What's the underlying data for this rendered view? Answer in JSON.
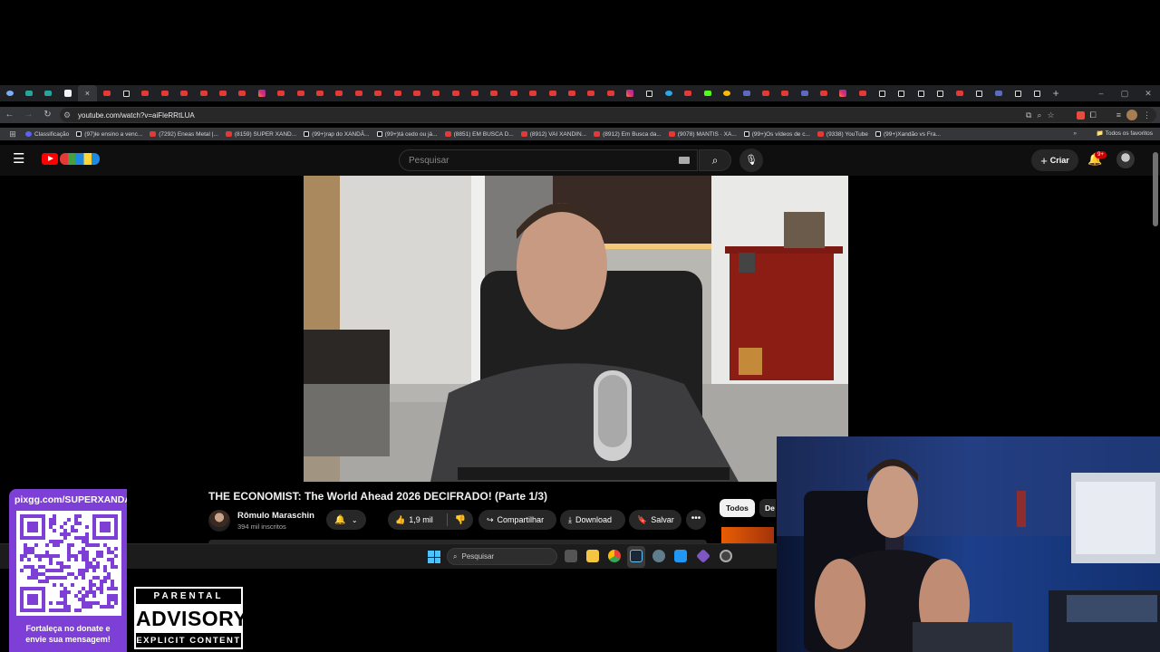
{
  "browser": {
    "tab_icons": [
      "tab-search",
      "browser-ext",
      "browser-ext",
      "blank",
      "active-close",
      "youtube",
      "tiktok",
      "youtube",
      "youtube",
      "youtube",
      "youtube",
      "youtube",
      "youtube",
      "instagram",
      "youtube",
      "youtube",
      "youtube",
      "youtube",
      "youtube",
      "youtube",
      "youtube",
      "youtube",
      "youtube",
      "youtube",
      "youtube",
      "youtube",
      "youtube",
      "youtube",
      "youtube",
      "youtube",
      "youtube",
      "youtube",
      "instagram",
      "tiktok",
      "telegram",
      "youtube",
      "kick",
      "google",
      "generic",
      "youtube",
      "youtube",
      "generic",
      "youtube",
      "instagram",
      "youtube",
      "tiktok",
      "tiktok",
      "tiktok",
      "tiktok",
      "youtube",
      "tiktok",
      "generic",
      "tiktok",
      "tiktok"
    ],
    "active_tab_close": "×",
    "new_tab": "+",
    "window_controls": [
      "–",
      "▢",
      "✕"
    ],
    "url": "youtube.com/watch?v=aiFleRRtLUA",
    "bookmarks": [
      {
        "icon": "discord",
        "label": "Classificação"
      },
      {
        "icon": "tiktok",
        "label": "(97)le ensino a venc..."
      },
      {
        "icon": "youtube",
        "label": "(7292) Eneas Metal |..."
      },
      {
        "icon": "youtube",
        "label": "(8159) SUPER XAND..."
      },
      {
        "icon": "tiktok",
        "label": "(99+)rap do XANDÃ..."
      },
      {
        "icon": "tiktok",
        "label": "(99+)tá cedo ou já..."
      },
      {
        "icon": "youtube",
        "label": "(8851) EM BUSCA D..."
      },
      {
        "icon": "youtube",
        "label": "(8912) VAI XANDIN..."
      },
      {
        "icon": "youtube",
        "label": "(8912) Em Busca da..."
      },
      {
        "icon": "youtube",
        "label": "(9078) MANTIS · XA..."
      },
      {
        "icon": "tiktok",
        "label": "(99+)Os vídeos de c..."
      },
      {
        "icon": "youtube",
        "label": "(9338) YouTube"
      },
      {
        "icon": "tiktok",
        "label": "(99+)Xandão vs Fra..."
      }
    ],
    "bookmarks_more": "»",
    "all_bookmarks": "Todos os favoritos"
  },
  "youtube": {
    "search_placeholder": "Pesquisar",
    "create_label": "Criar",
    "notification_badge": "9+",
    "video_title": "THE ECONOMIST: The World Ahead 2026 DECIFRADO! (Parte 1/3)",
    "channel_name": "Rômulo Maraschin",
    "subscribers": "394 mil inscritos",
    "likes": "1,9 mil",
    "share_label": "Compartilhar",
    "download_label": "Download",
    "save_label": "Salvar",
    "more_label": "•••",
    "chips": [
      "Todos",
      "De"
    ]
  },
  "taskbar": {
    "search_placeholder": "Pesquisar"
  },
  "overlay": {
    "qr_url": "pixgg.com/SUPERXANDAO",
    "qr_caption_line1": "Fortaleça no donate e",
    "qr_caption_line2": "envie sua mensagem!",
    "advisory_top": "PARENTAL",
    "advisory_mid": "ADVISORY",
    "advisory_bottom": "EXPLICIT CONTENT"
  },
  "colors": {
    "qr_panel": "#7d3fd6",
    "youtube_red": "#ff0000",
    "page_bg": "#0f0f0f"
  }
}
